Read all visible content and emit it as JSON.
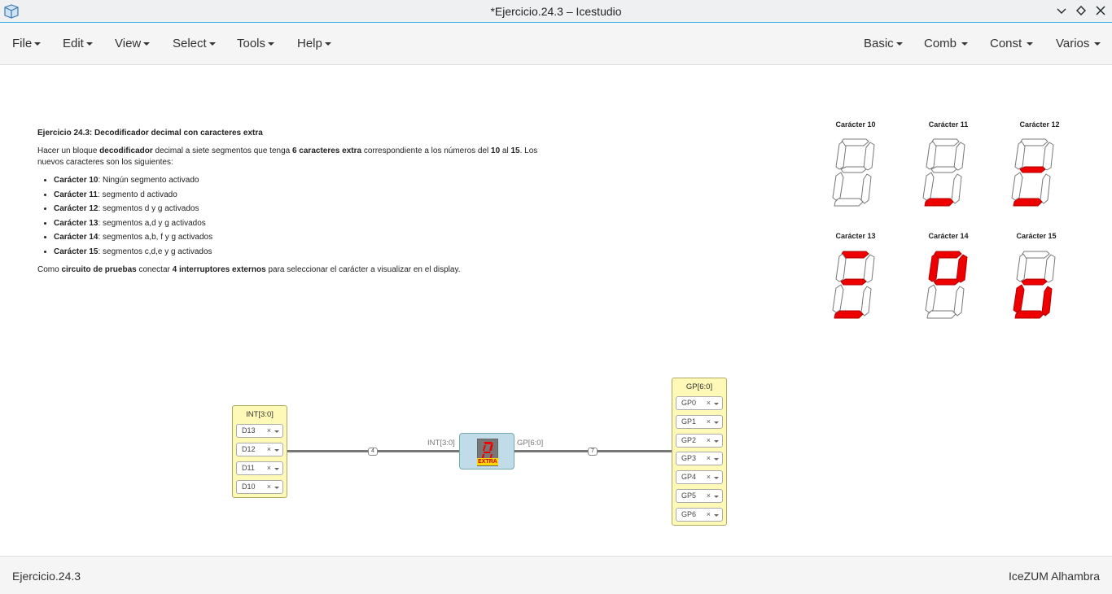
{
  "window": {
    "title": "*Ejercicio.24.3 – Icestudio"
  },
  "menu_left": [
    "File",
    "Edit",
    "View",
    "Select",
    "Tools",
    "Help"
  ],
  "menu_right": [
    "Basic",
    "Comb",
    "Const",
    "Varios"
  ],
  "info": {
    "heading": "Ejercicio 24.3: Decodificador decimal con caracteres extra",
    "p1": {
      "t1": "Hacer un bloque ",
      "b1": "decodificador",
      "t2": " decimal a siete segmentos que tenga ",
      "b2": "6 caracteres extra",
      "t3": " correspondiente a los números del ",
      "b3": "10",
      "t4": " al ",
      "b4": "15",
      "t5": ". Los nuevos caracteres son los siguientes:"
    },
    "items": [
      {
        "b": "Carácter 10",
        "t": ": Ningún segmento activado"
      },
      {
        "b": "Carácter 11",
        "t": ": segmento d activado"
      },
      {
        "b": "Carácter 12",
        "t": ": segmentos d y g activados"
      },
      {
        "b": "Carácter 13",
        "t": ": segmentos a,d y g activados"
      },
      {
        "b": "Carácter 14",
        "t": ": segmentos a,b, f y g activados"
      },
      {
        "b": "Carácter 15",
        "t": ": segmentos c,d,e y g activados"
      }
    ],
    "p2": {
      "t1": "Como ",
      "b1": "circuito de pruebas",
      "t2": " conectar ",
      "b2": "4 interruptores externos",
      "t3": " para seleccionar el carácter a visualizar en el display."
    }
  },
  "segment_colors": {
    "on": "#ee0000",
    "off": "#ffffff"
  },
  "characters": [
    {
      "title": "Carácter 10",
      "segments_on": []
    },
    {
      "title": "Carácter 11",
      "segments_on": [
        "d"
      ]
    },
    {
      "title": "Carácter 12",
      "segments_on": [
        "d",
        "g"
      ]
    },
    {
      "title": "Carácter 13",
      "segments_on": [
        "a",
        "d",
        "g"
      ]
    },
    {
      "title": "Carácter 14",
      "segments_on": [
        "a",
        "b",
        "f",
        "g"
      ]
    },
    {
      "title": "Carácter 15",
      "segments_on": [
        "c",
        "d",
        "e",
        "g"
      ]
    }
  ],
  "circuit": {
    "input_block": {
      "label": "INT[3:0]",
      "pins": [
        "D13",
        "D12",
        "D11",
        "D10"
      ]
    },
    "output_block": {
      "label": "GP[6:0]",
      "pins": [
        "GP0",
        "GP1",
        "GP2",
        "GP3",
        "GP4",
        "GP5",
        "GP6"
      ]
    },
    "module": {
      "input_port": "INT[3:0]",
      "output_port": "GP[6:0]",
      "badge": "EXTRA"
    },
    "wire_in_width": "4",
    "wire_out_width": "7",
    "pin_clear": "×"
  },
  "status": {
    "left": "Ejercicio.24.3",
    "right": "IceZUM Alhambra"
  }
}
